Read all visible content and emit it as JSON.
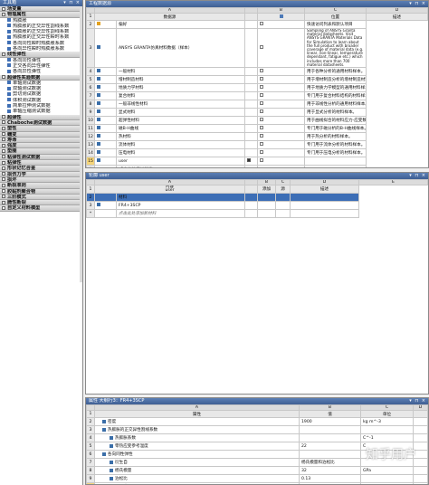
{
  "toolbox": {
    "title": "工具箱",
    "controls": "▾ ⊓ ×",
    "items": [
      {
        "label": "场变量",
        "kind": "cat"
      },
      {
        "label": "物理属性",
        "kind": "cat"
      },
      {
        "label": "热膨胀",
        "kind": "sub"
      },
      {
        "label": "热膨胀的正交异性割线系数",
        "kind": "sub"
      },
      {
        "label": "热膨胀的正交异性割线系数",
        "kind": "sub"
      },
      {
        "label": "热膨胀的正交异性瞬时系数",
        "kind": "sub"
      },
      {
        "label": "各向同性瞬时热膨胀系数",
        "kind": "sub"
      },
      {
        "label": "各向异性瞬时热膨胀系数",
        "kind": "sub"
      },
      {
        "label": "线性弹性",
        "kind": "cat"
      },
      {
        "label": "各向同性弹性",
        "kind": "sub"
      },
      {
        "label": "正交各向异性弹性",
        "kind": "sub"
      },
      {
        "label": "各向异性弹性",
        "kind": "sub"
      },
      {
        "label": "超弹性实验数据",
        "kind": "cat"
      },
      {
        "label": "单轴测试数据",
        "kind": "sub"
      },
      {
        "label": "双轴测试数据",
        "kind": "sub"
      },
      {
        "label": "剪切测试数据",
        "kind": "sub"
      },
      {
        "label": "体积测试数据",
        "kind": "sub"
      },
      {
        "label": "简单拉伸测试数据",
        "kind": "sub"
      },
      {
        "label": "单轴压缩测试数据",
        "kind": "sub"
      },
      {
        "label": "超弹性",
        "kind": "cat"
      },
      {
        "label": "Chaboche测试数据",
        "kind": "cat"
      },
      {
        "label": "塑性",
        "kind": "cat"
      },
      {
        "label": "蠕变",
        "kind": "cat"
      },
      {
        "label": "寿命",
        "kind": "cat"
      },
      {
        "label": "强度",
        "kind": "cat"
      },
      {
        "label": "垫圈",
        "kind": "cat"
      },
      {
        "label": "粘弹性测试数据",
        "kind": "cat"
      },
      {
        "label": "粘弹性",
        "kind": "cat"
      },
      {
        "label": "形状记忆合金",
        "kind": "cat"
      },
      {
        "label": "损伤力学",
        "kind": "cat"
      },
      {
        "label": "损坏",
        "kind": "cat"
      },
      {
        "label": "断裂准则",
        "kind": "cat"
      },
      {
        "label": "胶黏剂聚合物",
        "kind": "cat"
      },
      {
        "label": "三阶模式",
        "kind": "cat"
      },
      {
        "label": "脆性断裂",
        "kind": "cat"
      },
      {
        "label": "自定义材料模型",
        "kind": "cat"
      }
    ]
  },
  "library": {
    "title": "工程数据源",
    "cols": [
      "A",
      "B",
      "C",
      "D"
    ],
    "headers": [
      "数据源",
      "",
      "位置",
      "描述"
    ],
    "rows": [
      {
        "n": "1",
        "name": "",
        "desc": "",
        "kind": "header"
      },
      {
        "n": "2",
        "name": "偏好",
        "desc": "快速访问列表和默认项目",
        "icon": "star",
        "checked": false
      },
      {
        "n": "3",
        "name": "ANSYS GRANTA仿真材料数据（样本）",
        "desc": "Sampling of ANSYS Granta material datasheets. Visit ANSYS GRANTA Materials Data for Simulation to learn about the full product with broader coverage of material data (e.g. linear, non-linear, temperature dependant, fatigue etc.) which includes more than 700 material datasheets.",
        "icon": "lib",
        "checked": false,
        "tall": true
      },
      {
        "n": "4",
        "name": "一般材料",
        "desc": "用于各种分析的通用材料样本。",
        "icon": "lib",
        "checked": false
      },
      {
        "n": "5",
        "name": "增材制造材料",
        "desc": "用于增材制造分析的增材制造材料样本。",
        "icon": "lib",
        "checked": false
      },
      {
        "n": "6",
        "name": "地质力学材料",
        "desc": "用于地质力学模型的通用材料样本。",
        "icon": "lib",
        "checked": false
      },
      {
        "n": "7",
        "name": "复合材料",
        "desc": "专门用于复合材料结构的材料样本。",
        "icon": "lib",
        "checked": false
      },
      {
        "n": "8",
        "name": "一般非线性材料",
        "desc": "用于非线性分析的通用材料样本。",
        "icon": "lib",
        "checked": false
      },
      {
        "n": "9",
        "name": "显式材料",
        "desc": "用于显式分析的材料样本。",
        "icon": "lib",
        "checked": false
      },
      {
        "n": "10",
        "name": "超弹性材料",
        "desc": "用于曲线拟合的材料应力-应变数据样本。",
        "icon": "lib",
        "checked": false
      },
      {
        "n": "11",
        "name": "磁B-H曲线",
        "desc": "专门用于磁分析的B-H曲线样本。",
        "icon": "lib",
        "checked": false
      },
      {
        "n": "12",
        "name": "热材料",
        "desc": "用于热分析的材料样本。",
        "icon": "lib",
        "checked": false
      },
      {
        "n": "13",
        "name": "流体材料",
        "desc": "专门用于流体分析的材料样本。",
        "icon": "lib",
        "checked": false
      },
      {
        "n": "14",
        "name": "压电材料",
        "desc": "专门用于压电分析的材料样本。",
        "icon": "lib",
        "checked": false
      },
      {
        "n": "15",
        "name": "user",
        "desc": "",
        "icon": "lib",
        "checked": true,
        "selected": true
      },
      {
        "n": "*",
        "name": "点击此处添加新库",
        "desc": "",
        "italic": true
      }
    ]
  },
  "outline": {
    "title": "轮廓 user",
    "cols": [
      "A",
      "B",
      "C",
      "D",
      "E"
    ],
    "headers": [
      "内容\nuser",
      "",
      "添加",
      "源",
      "描述"
    ],
    "rows": [
      {
        "n": "1",
        "name": "",
        "kind": "header"
      },
      {
        "n": "2",
        "name": "材料",
        "kind": "blue"
      },
      {
        "n": "3",
        "name": "FR4+3SCP",
        "icon": "lib"
      },
      {
        "n": "*",
        "name": "点击此处添加新材料",
        "italic": true
      }
    ]
  },
  "properties": {
    "title": "属性 大纲行3：FR4+3SCP",
    "cols": [
      "A",
      "B",
      "C",
      "D"
    ],
    "headers": [
      "属性",
      "值",
      "单位",
      ""
    ],
    "rows": [
      {
        "n": "1",
        "a": "",
        "b": "",
        "c": "",
        "kind": "header"
      },
      {
        "n": "2",
        "a": "密度",
        "b": "1900",
        "c": "kg m^-3",
        "ind": 1
      },
      {
        "n": "3",
        "a": "热膨胀的正交异性割线系数",
        "b": "",
        "c": "",
        "ind": 1
      },
      {
        "n": "4",
        "a": "热膨胀系数",
        "b": "",
        "c": "C^-1",
        "ind": 2
      },
      {
        "n": "5",
        "a": "零热应变参考温度",
        "b": "22",
        "c": "C",
        "ind": 2
      },
      {
        "n": "6",
        "a": "各向同性弹性",
        "b": "",
        "c": "",
        "ind": 1
      },
      {
        "n": "7",
        "a": "衍生自",
        "b": "杨氏模量和泊松比",
        "c": "",
        "ind": 2
      },
      {
        "n": "8",
        "a": "杨氏模量",
        "b": "32",
        "c": "GPa",
        "ind": 2
      },
      {
        "n": "9",
        "a": "泊松比",
        "b": "0.13",
        "c": "",
        "ind": 2
      },
      {
        "n": "10",
        "a": "体积模量",
        "b": "1.3370E+10",
        "c": "Pa",
        "ind": 2,
        "sel": true
      },
      {
        "n": "11",
        "a": "剪切模量",
        "b": "1.3920E+10",
        "c": "Pa",
        "ind": 2
      }
    ]
  },
  "watermark": "知乎用户"
}
